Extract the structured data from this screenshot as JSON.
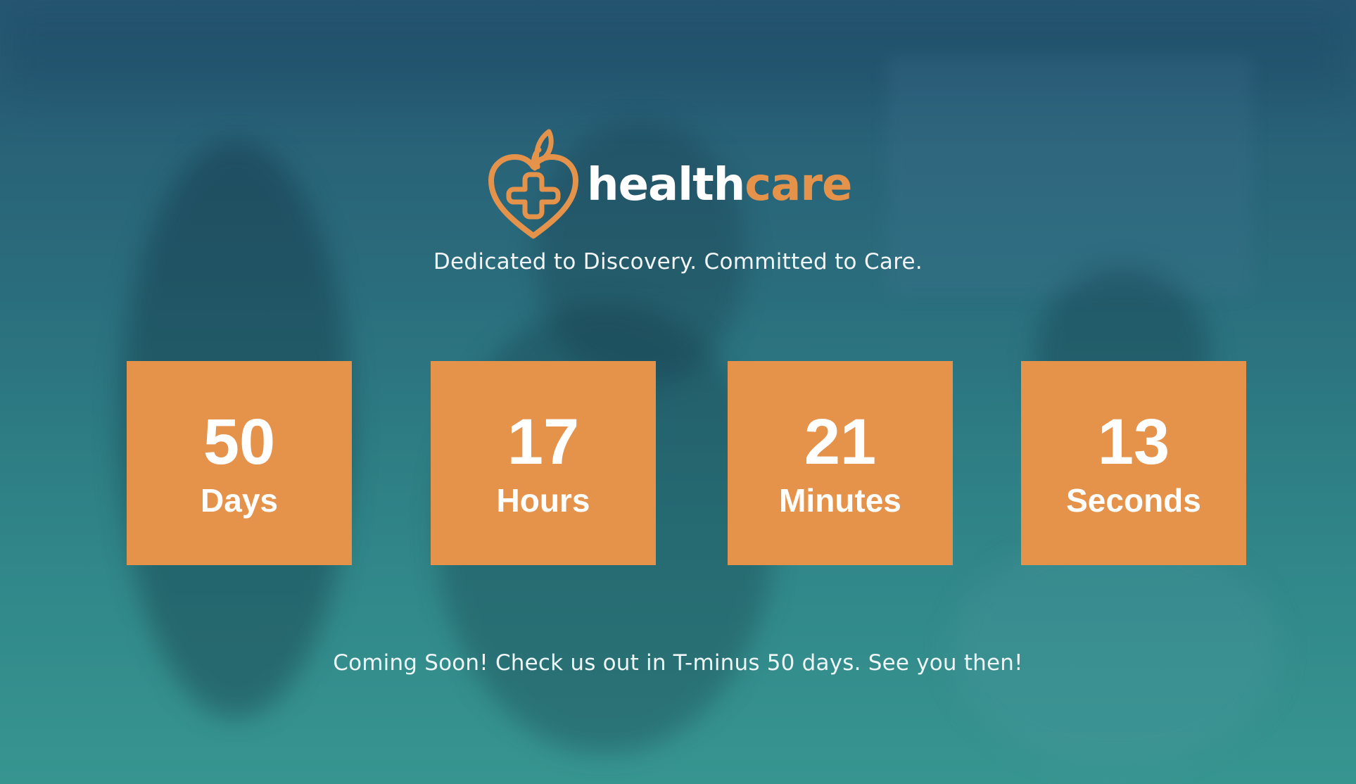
{
  "brand": {
    "name_part1": "health",
    "name_part2": "care",
    "logo_icon": "heart-cross-apple-icon",
    "accent_color": "#e5924b"
  },
  "tagline": "Dedicated to Discovery. Committed to Care.",
  "countdown": [
    {
      "value": "50",
      "unit": "Days"
    },
    {
      "value": "17",
      "unit": "Hours"
    },
    {
      "value": "21",
      "unit": "Minutes"
    },
    {
      "value": "13",
      "unit": "Seconds"
    }
  ],
  "footer_note": "Coming Soon! Check us out in T-minus 50 days. See you then!",
  "colors": {
    "background_top": "#275873",
    "background_bottom": "#379590",
    "counter_box": "#e5924b",
    "text": "#ffffff"
  }
}
